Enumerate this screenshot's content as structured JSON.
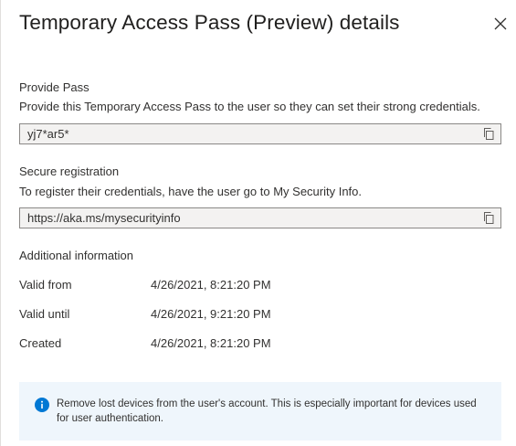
{
  "panel": {
    "title": "Temporary Access Pass (Preview) details"
  },
  "provide_pass": {
    "heading": "Provide Pass",
    "description": "Provide this Temporary Access Pass to the user so they can set their strong credentials.",
    "value": "yj7*ar5*"
  },
  "secure_registration": {
    "heading": "Secure registration",
    "description": "To register their credentials, have the user go to My Security Info.",
    "value": "https://aka.ms/mysecurityinfo"
  },
  "additional_info": {
    "heading": "Additional information",
    "rows": [
      {
        "label": "Valid from",
        "value": "4/26/2021, 8:21:20 PM"
      },
      {
        "label": "Valid until",
        "value": "4/26/2021, 9:21:20 PM"
      },
      {
        "label": "Created",
        "value": "4/26/2021, 8:21:20 PM"
      }
    ]
  },
  "banner": {
    "text": "Remove lost devices from the user's account. This is especially important for devices used for user authentication.",
    "icon": "info-icon"
  },
  "icons": {
    "close": "close-icon",
    "copy": "copy-icon"
  },
  "colors": {
    "accent": "#0078d4",
    "banner_bg": "#eff6fc",
    "field_bg": "#f3f2f1"
  }
}
